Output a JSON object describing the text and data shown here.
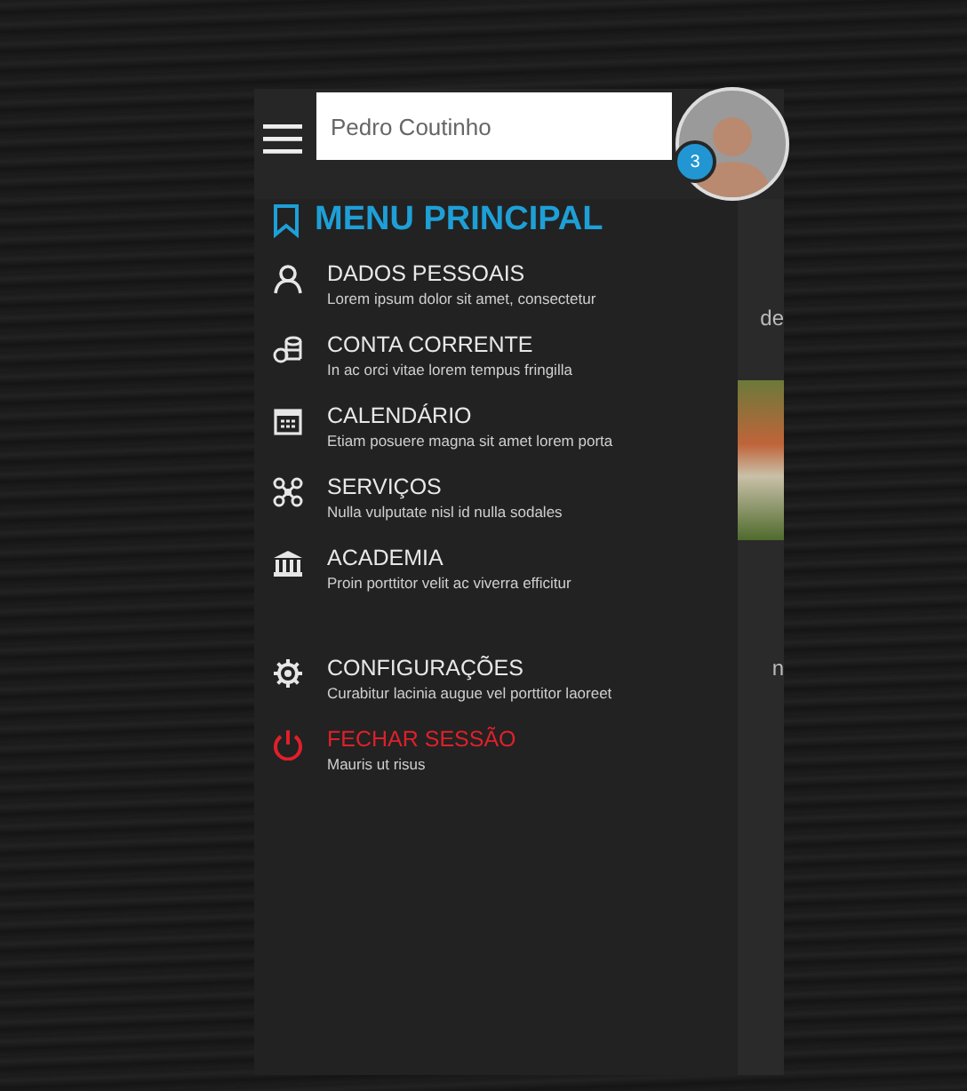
{
  "header": {
    "search": {
      "value": "Pedro Coutinho"
    },
    "notification_badge": "3"
  },
  "menu": {
    "title": "MENU PRINCIPAL",
    "groups": [
      [
        {
          "label": "DADOS PESSOAIS",
          "subtitle": "Lorem ipsum dolor sit amet, consectetur",
          "kind": "normal"
        },
        {
          "label": "CONTA CORRENTE",
          "subtitle": "In ac orci vitae lorem tempus fringilla",
          "kind": "normal"
        },
        {
          "label": "CALENDÁRIO",
          "subtitle": "Etiam posuere magna sit amet lorem porta",
          "kind": "normal"
        },
        {
          "label": "SERVIÇOS",
          "subtitle": "Nulla vulputate nisl id nulla sodales",
          "kind": "normal"
        },
        {
          "label": "ACADEMIA",
          "subtitle": "Proin porttitor velit ac viverra efficitur",
          "kind": "normal"
        }
      ],
      [
        {
          "label": "CONFIGURAÇÕES",
          "subtitle": "Curabitur lacinia augue vel porttitor laoreet",
          "kind": "normal"
        },
        {
          "label": "FECHAR SESSÃO",
          "subtitle": "Mauris ut risus",
          "kind": "danger"
        }
      ]
    ]
  },
  "background_content": {
    "fragments": [
      "de",
      "n"
    ]
  }
}
